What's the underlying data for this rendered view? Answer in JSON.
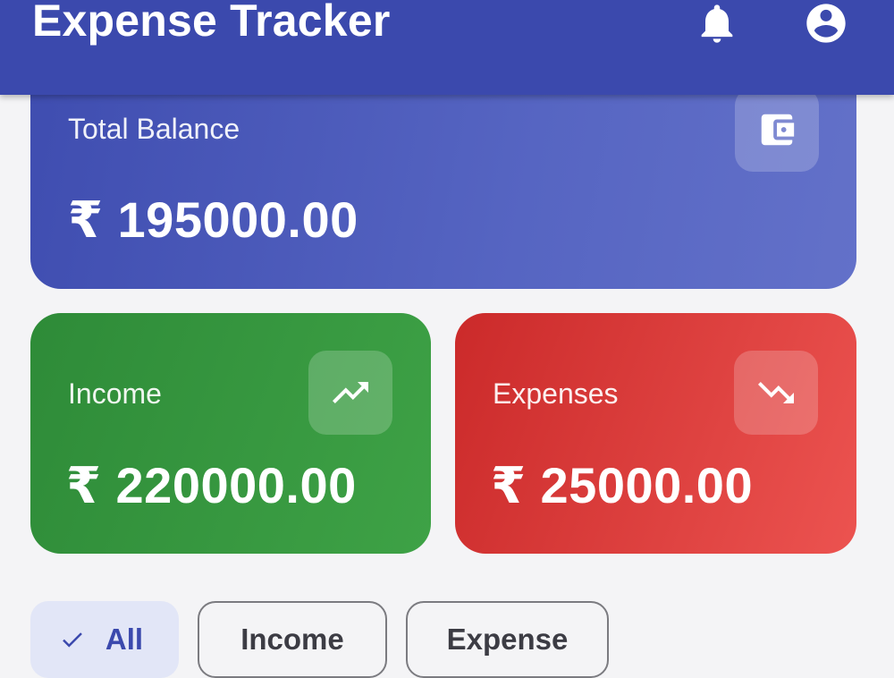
{
  "appbar": {
    "title": "Expense Tracker",
    "bell_icon": "notifications-bell-icon",
    "account_icon": "account-circle-icon"
  },
  "balance": {
    "label": "Total Balance",
    "amount": "₹ 195000.00",
    "icon": "wallet-icon"
  },
  "income": {
    "label": "Income",
    "amount": "₹ 220000.00",
    "icon": "trending-up-icon"
  },
  "expenses": {
    "label": "Expenses",
    "amount": "₹ 25000.00",
    "icon": "trending-down-icon"
  },
  "filters": {
    "all": "All",
    "income": "Income",
    "expense": "Expense",
    "selected": "All"
  },
  "colors": {
    "primary": "#3b49ad",
    "income": "#3ea246",
    "expense": "#e44646",
    "background": "#f4f4f6"
  }
}
